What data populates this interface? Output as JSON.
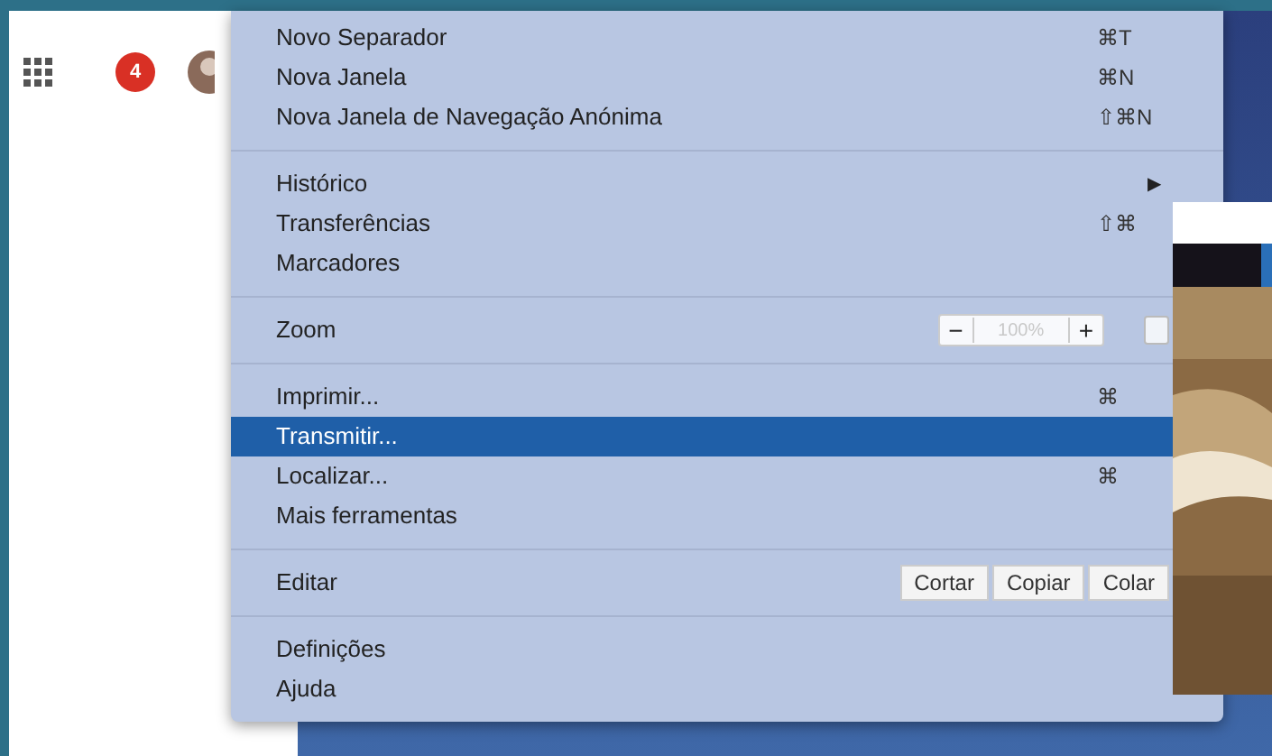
{
  "page": {
    "notification_count": "4"
  },
  "menu": {
    "groups": [
      {
        "items": [
          {
            "kind": "item",
            "label": "Novo Separador",
            "shortcut": "⌘T",
            "selected": false
          },
          {
            "kind": "item",
            "label": "Nova Janela",
            "shortcut": "⌘N",
            "selected": false
          },
          {
            "kind": "item",
            "label": "Nova Janela de Navegação Anónima",
            "shortcut": "⇧⌘N",
            "selected": false
          }
        ]
      },
      {
        "items": [
          {
            "kind": "submenu",
            "label": "Histórico",
            "arrow": "▶",
            "selected": false
          },
          {
            "kind": "item",
            "label": "Transferências",
            "shortcut": "⇧⌘",
            "selected": false
          },
          {
            "kind": "item",
            "label": "Marcadores",
            "selected": false
          }
        ]
      },
      {
        "items": [
          {
            "kind": "zoom",
            "label": "Zoom",
            "minus": "−",
            "value": "100%",
            "plus": "+"
          }
        ]
      },
      {
        "items": [
          {
            "kind": "item",
            "label": "Imprimir...",
            "shortcut": "⌘",
            "selected": false
          },
          {
            "kind": "item",
            "label": "Transmitir...",
            "selected": true
          },
          {
            "kind": "item",
            "label": "Localizar...",
            "shortcut": "⌘",
            "selected": false
          },
          {
            "kind": "item",
            "label": "Mais ferramentas",
            "selected": false
          }
        ]
      },
      {
        "items": [
          {
            "kind": "edit",
            "label": "Editar",
            "buttons": [
              "Cortar",
              "Copiar",
              "Colar"
            ]
          }
        ]
      },
      {
        "items": [
          {
            "kind": "item",
            "label": "Definições",
            "selected": false
          },
          {
            "kind": "item",
            "label": "Ajuda",
            "selected": false
          }
        ]
      }
    ]
  }
}
